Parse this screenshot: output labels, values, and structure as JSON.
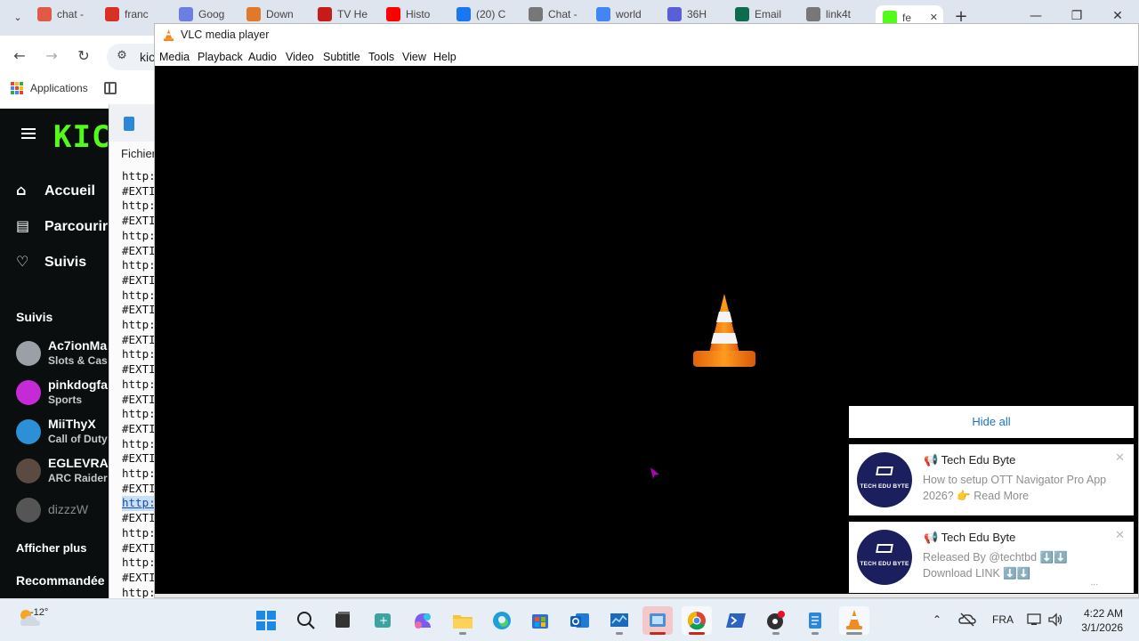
{
  "browser": {
    "tabs": [
      {
        "label": "chat -",
        "icon": "asterisk-icon",
        "color": "#e05a47"
      },
      {
        "label": "franc",
        "icon": "france-icon",
        "color": "#d93025"
      },
      {
        "label": "Goog",
        "icon": "gemini-icon",
        "color": "#6b7fe0"
      },
      {
        "label": "Down",
        "icon": "cloud-icon",
        "color": "#e07a2a"
      },
      {
        "label": "TV He",
        "icon": "tv-icon",
        "color": "#c51b1b"
      },
      {
        "label": "Histo",
        "icon": "youtube-icon",
        "color": "#ff0000"
      },
      {
        "label": "(20) C",
        "icon": "facebook-icon",
        "color": "#1877f2"
      },
      {
        "label": "Chat -",
        "icon": "globe-icon",
        "color": "#777777"
      },
      {
        "label": "world",
        "icon": "google-icon",
        "color": "#4285f4"
      },
      {
        "label": "36H",
        "icon": "play-icon",
        "color": "#5b5fd6"
      },
      {
        "label": "Email",
        "icon": "mail-icon",
        "color": "#0f6b4f"
      },
      {
        "label": "link4t",
        "icon": "globe-icon",
        "color": "#777777"
      },
      {
        "label": "fe",
        "icon": "kick-icon",
        "color": "#53fc18"
      }
    ],
    "omnibox_text": "kic",
    "bookmarks": {
      "apps_label": "Applications"
    }
  },
  "kick": {
    "logo": "KIC",
    "nav": [
      {
        "label": "Accueil",
        "icon": "home-icon"
      },
      {
        "label": "Parcourir",
        "icon": "browse-icon"
      },
      {
        "label": "Suivis",
        "icon": "heart-icon"
      }
    ],
    "following_header": "Suivis",
    "channels": [
      {
        "name": "Ac7ionMa",
        "category": "Slots & Cas",
        "avatar_color": "#9aa0a6"
      },
      {
        "name": "pinkdogfa",
        "category": "Sports",
        "avatar_color": "#c42bd6"
      },
      {
        "name": "MiiThyX",
        "category": "Call of Duty",
        "avatar_color": "#2d8fd5"
      },
      {
        "name": "EGLEVRA",
        "category": "ARC Raider",
        "avatar_color": "#5a4a42"
      },
      {
        "name": "dizzzW",
        "category": "",
        "avatar_color": "#555555"
      }
    ],
    "show_more": "Afficher plus",
    "recommended": "Recommandée"
  },
  "notepad": {
    "menu": "Fichier",
    "lines": [
      "http:",
      "#EXTI",
      "http:",
      "#EXTI",
      "http:",
      "#EXTI",
      "http:",
      "#EXTI",
      "http:",
      "#EXTI",
      "http:",
      "#EXTI",
      "http:",
      "#EXTI",
      "http:",
      "#EXTI",
      "http:",
      "#EXTI",
      "http:",
      "#EXTI",
      "http:",
      "#EXTI",
      "http:",
      "#EXTI",
      "http:",
      "#EXTI",
      "http:",
      "#EXTI",
      "http:"
    ],
    "highlighted_line": 22
  },
  "vlc": {
    "title": "VLC media player",
    "menu": [
      "Media",
      "Playback",
      "Audio",
      "Video",
      "Subtitle",
      "Tools",
      "View",
      "Help"
    ]
  },
  "notifications": {
    "hide_all": "Hide all",
    "items": [
      {
        "title": "📢 Tech Edu Byte",
        "logo_text": "TECH EDU BYTE",
        "body": "How to setup OTT Navigator Pro App 2026? 👉 Read More"
      },
      {
        "title": "📢 Tech Edu Byte",
        "logo_text": "TECH EDU BYTE",
        "body": "Released By @techtbd ⬇️⬇️ Download LINK ⬇️⬇️",
        "more": "..."
      }
    ]
  },
  "taskbar": {
    "weather_temp": "-12°",
    "language": "FRA",
    "time": "4:22 AM",
    "date": "3/1/2026"
  }
}
